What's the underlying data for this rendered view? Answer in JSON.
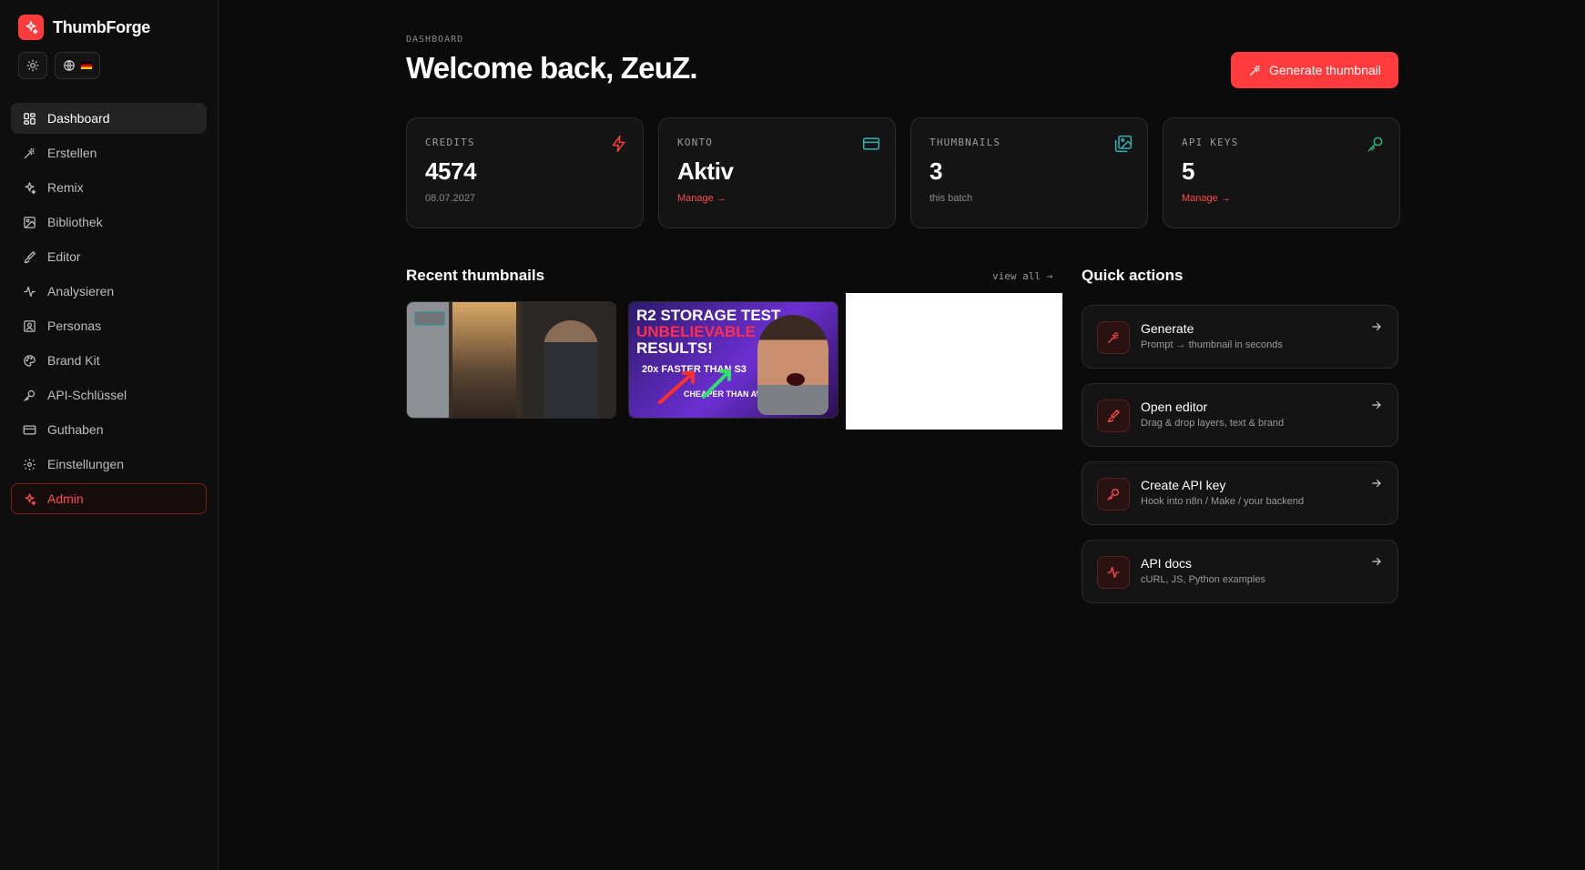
{
  "brand": {
    "name": "ThumbForge"
  },
  "nav": {
    "items": [
      {
        "label": "Dashboard",
        "icon": "dashboard-icon"
      },
      {
        "label": "Erstellen",
        "icon": "wand-icon"
      },
      {
        "label": "Remix",
        "icon": "sparkles-icon"
      },
      {
        "label": "Bibliothek",
        "icon": "images-icon"
      },
      {
        "label": "Editor",
        "icon": "brush-icon"
      },
      {
        "label": "Analysieren",
        "icon": "activity-icon"
      },
      {
        "label": "Personas",
        "icon": "user-square-icon"
      },
      {
        "label": "Brand Kit",
        "icon": "palette-icon"
      },
      {
        "label": "API-Schlüssel",
        "icon": "key-icon"
      },
      {
        "label": "Guthaben",
        "icon": "credit-card-icon"
      },
      {
        "label": "Einstellungen",
        "icon": "gear-icon"
      }
    ],
    "admin": {
      "label": "Admin",
      "icon": "sparkles-icon"
    }
  },
  "header": {
    "eyebrow": "DASHBOARD",
    "title": "Welcome back, ZeuZ.",
    "generate_label": "Generate thumbnail"
  },
  "stats": [
    {
      "label": "CREDITS",
      "value": "4574",
      "sub": "08.07.2027",
      "icon": "zap-icon",
      "color": "#ff3b3b"
    },
    {
      "label": "KONTO",
      "value": "Aktiv",
      "link": "Manage →",
      "icon": "credit-card-icon",
      "color": "#2fb3b3"
    },
    {
      "label": "THUMBNAILS",
      "value": "3",
      "sub": "this batch",
      "icon": "images-icon",
      "color": "#2fb3b3"
    },
    {
      "label": "API KEYS",
      "value": "5",
      "link": "Manage →",
      "icon": "key-icon",
      "color": "#2fb37a"
    }
  ],
  "recent": {
    "title": "Recent thumbnails",
    "view_all": "view all →",
    "thumb2": {
      "line1": "R2 STORAGE TEST",
      "line2": "UNBELIEVABLE",
      "line3": "RESULTS!",
      "line4": "20x FASTER THAN S3",
      "line5": "CHEAPER THAN AWS"
    }
  },
  "quick_actions": {
    "title": "Quick actions",
    "items": [
      {
        "title": "Generate",
        "sub": "Prompt → thumbnail in seconds",
        "icon": "wand-icon"
      },
      {
        "title": "Open editor",
        "sub": "Drag & drop layers, text & brand",
        "icon": "brush-icon"
      },
      {
        "title": "Create API key",
        "sub": "Hook into n8n / Make / your backend",
        "icon": "key-icon"
      },
      {
        "title": "API docs",
        "sub": "cURL, JS, Python examples",
        "icon": "activity-icon"
      }
    ]
  },
  "colors": {
    "accent": "#ff3b3b",
    "background": "#0b0b0b",
    "card": "#141414"
  }
}
